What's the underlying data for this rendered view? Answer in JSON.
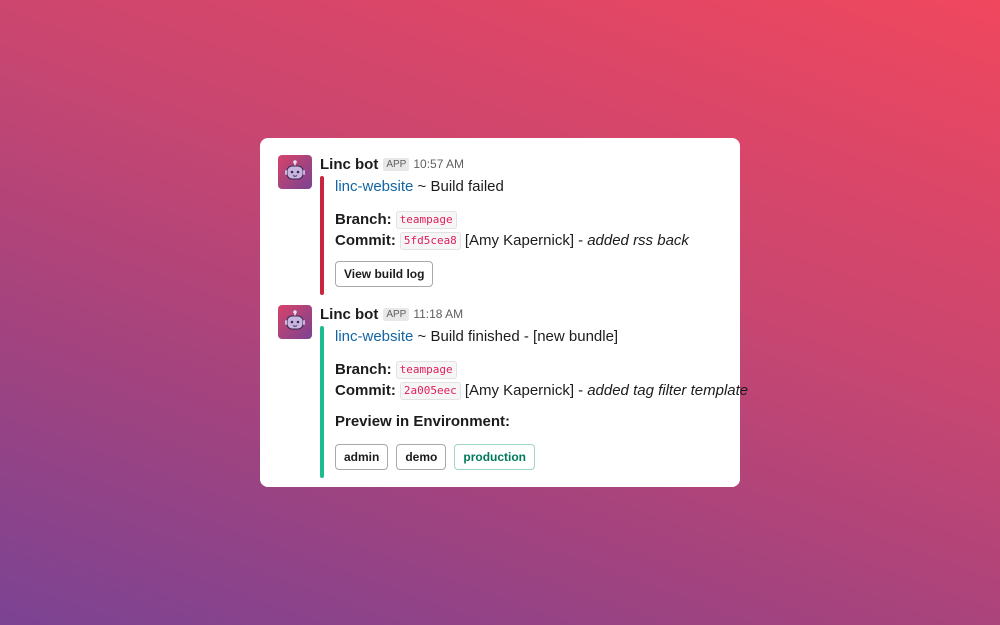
{
  "colors": {
    "failed_bar": "#c8253e",
    "success_bar": "#1dbc8f",
    "link": "#1264a3",
    "code_text": "#e01e5a"
  },
  "messages": [
    {
      "sender": "Linc bot",
      "badge": "APP",
      "time": "10:57 AM",
      "avatar_icon": "robot-icon",
      "status": "failed",
      "repo_link": "linc-website",
      "title_rest": "~ Build failed",
      "branch_label": "Branch:",
      "branch": "teampage",
      "commit_label": "Commit:",
      "commit": "5fd5cea8",
      "author": "[Amy Kapernick] -",
      "commit_message": "added rss back",
      "buttons": [
        {
          "label": "View build log"
        }
      ]
    },
    {
      "sender": "Linc bot",
      "badge": "APP",
      "time": "11:18 AM",
      "avatar_icon": "robot-icon",
      "status": "finished",
      "repo_link": "linc-website",
      "title_rest": "~ Build finished - [new bundle]",
      "branch_label": "Branch:",
      "branch": "teampage",
      "commit_label": "Commit:",
      "commit": "2a005eec",
      "author": "[Amy Kapernick] -",
      "commit_message": "added tag filter template",
      "preview_label": "Preview in Environment:",
      "buttons": [
        {
          "label": "admin"
        },
        {
          "label": "demo"
        },
        {
          "label": "production"
        }
      ]
    }
  ]
}
